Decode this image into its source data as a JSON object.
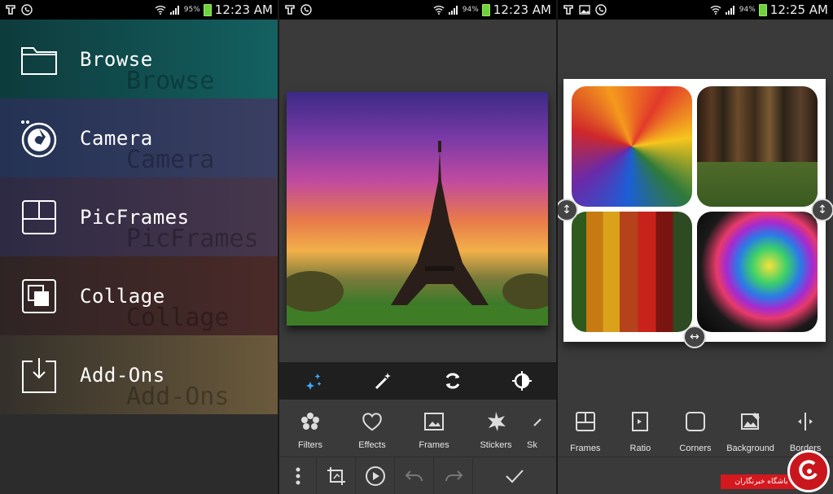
{
  "panel1": {
    "status": {
      "battery_pct": "95%",
      "time": "12:23 AM"
    },
    "menu": [
      {
        "label": "Browse",
        "icon": "folder-icon",
        "ghost": "Browse"
      },
      {
        "label": "Camera",
        "icon": "camera-aperture-icon",
        "ghost": "Camera"
      },
      {
        "label": "PicFrames",
        "icon": "picframes-icon",
        "ghost": "PicFrames"
      },
      {
        "label": "Collage",
        "icon": "collage-icon",
        "ghost": "Collage"
      },
      {
        "label": "Add-Ons",
        "icon": "add-ons-download-icon",
        "ghost": "Add-Ons"
      }
    ]
  },
  "panel2": {
    "status": {
      "battery_pct": "94%",
      "time": "12:23 AM"
    },
    "toolbar_icons": [
      "sparkles-icon",
      "magic-wand-icon",
      "rotate-icon",
      "contrast-icon"
    ],
    "tools": [
      {
        "label": "Filters",
        "icon": "filters-icon"
      },
      {
        "label": "Effects",
        "icon": "effects-icon"
      },
      {
        "label": "Frames",
        "icon": "frames-icon"
      },
      {
        "label": "Stickers",
        "icon": "stickers-icon"
      },
      {
        "label": "Sk",
        "icon": "sketch-icon"
      }
    ],
    "bottom_icons": [
      "more-vertical-icon",
      "crop-icon",
      "play-icon",
      "undo-icon",
      "redo-icon",
      "checkmark-icon"
    ]
  },
  "panel3": {
    "status": {
      "battery_pct": "94%",
      "time": "12:25 AM"
    },
    "tools": [
      {
        "label": "Frames",
        "icon": "frames-icon"
      },
      {
        "label": "Ratio",
        "icon": "ratio-icon"
      },
      {
        "label": "Corners",
        "icon": "corners-icon"
      },
      {
        "label": "Background",
        "icon": "background-icon"
      },
      {
        "label": "Borders",
        "icon": "borders-icon"
      }
    ],
    "watermark": "باشگاه خبرنگاران"
  },
  "colors": {
    "accent_blue": "#3fa8ff",
    "battery_green": "#6fd23a",
    "watermark_red": "#d4181e"
  }
}
